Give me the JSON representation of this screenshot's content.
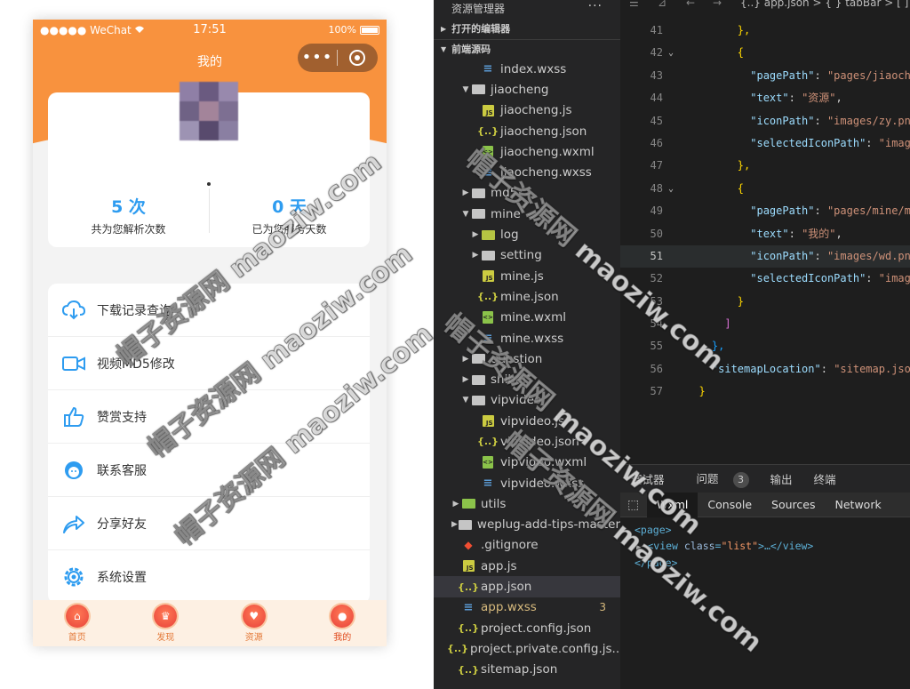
{
  "phone": {
    "status": {
      "carrier": "●●●●● WeChat",
      "time": "17:51",
      "battery": "100%"
    },
    "nav_title": "我的",
    "capsule_more": "•••",
    "stats": [
      {
        "value": "5 次",
        "label": "共为您解析次数"
      },
      {
        "value": "0 天",
        "label": "已为您服务天数"
      }
    ],
    "menu": [
      {
        "label": "下载记录查询",
        "icon": "cloud-download-icon"
      },
      {
        "label": "视频MD5修改",
        "icon": "video-camera-icon"
      },
      {
        "label": "赞赏支持",
        "icon": "thumbs-up-icon"
      },
      {
        "label": "联系客服",
        "icon": "customer-service-icon"
      },
      {
        "label": "分享好友",
        "icon": "share-arrow-icon"
      },
      {
        "label": "系统设置",
        "icon": "settings-gear-icon"
      }
    ],
    "tabs": [
      {
        "label": "首页",
        "icon": "home-icon"
      },
      {
        "label": "发现",
        "icon": "crown-icon"
      },
      {
        "label": "资源",
        "icon": "heart-icon"
      },
      {
        "label": "我的",
        "icon": "user-icon"
      }
    ],
    "accent": "#f8923e",
    "stat_color": "#2e9cf0"
  },
  "explorer": {
    "title": "资源管理器",
    "more": "···",
    "sections": [
      "打开的编辑器",
      "前端源码"
    ],
    "tree": [
      {
        "name": "index.wxss",
        "type": "css",
        "indent": 3
      },
      {
        "name": "jiaocheng",
        "type": "folder-open",
        "indent": 2
      },
      {
        "name": "jiaocheng.js",
        "type": "js",
        "indent": 3
      },
      {
        "name": "jiaocheng.json",
        "type": "json",
        "indent": 3
      },
      {
        "name": "jiaocheng.wxml",
        "type": "wxml",
        "indent": 3
      },
      {
        "name": "jiaocheng.wxss",
        "type": "css",
        "indent": 3
      },
      {
        "name": "md5",
        "type": "folder",
        "indent": 2
      },
      {
        "name": "mine",
        "type": "folder-open",
        "indent": 2
      },
      {
        "name": "log",
        "type": "folder-log",
        "indent": 3
      },
      {
        "name": "setting",
        "type": "folder",
        "indent": 3
      },
      {
        "name": "mine.js",
        "type": "js",
        "indent": 3
      },
      {
        "name": "mine.json",
        "type": "json",
        "indent": 3
      },
      {
        "name": "mine.wxml",
        "type": "wxml",
        "indent": 3
      },
      {
        "name": "mine.wxss",
        "type": "css",
        "indent": 3
      },
      {
        "name": "question",
        "type": "folder",
        "indent": 2
      },
      {
        "name": "shibai",
        "type": "folder",
        "indent": 2
      },
      {
        "name": "vipvideo",
        "type": "folder-open",
        "indent": 2
      },
      {
        "name": "vipvideo.js",
        "type": "js",
        "indent": 3
      },
      {
        "name": "vipvideo.json",
        "type": "json",
        "indent": 3
      },
      {
        "name": "vipvideo.wxml",
        "type": "wxml",
        "indent": 3
      },
      {
        "name": "vipvideo.wxss",
        "type": "css",
        "indent": 3
      },
      {
        "name": "utils",
        "type": "folder-utils",
        "indent": 1
      },
      {
        "name": "weplug-add-tips-master",
        "type": "folder",
        "indent": 1
      },
      {
        "name": ".gitignore",
        "type": "git",
        "indent": 1
      },
      {
        "name": "app.js",
        "type": "js",
        "indent": 1
      },
      {
        "name": "app.json",
        "type": "json",
        "indent": 1,
        "selected": true
      },
      {
        "name": "app.wxss",
        "type": "css",
        "indent": 1,
        "badge": "3",
        "modified": true
      },
      {
        "name": "project.config.json",
        "type": "json",
        "indent": 1
      },
      {
        "name": "project.private.config.js...",
        "type": "json",
        "indent": 1
      },
      {
        "name": "sitemap.json",
        "type": "json",
        "indent": 1
      }
    ]
  },
  "editor": {
    "breadcrumb": "{..} app.json > { } tabBar > [ ]",
    "lines": [
      {
        "no": "41",
        "code": [
          [
            "p",
            "        "
          ],
          [
            "y",
            "},"
          ]
        ]
      },
      {
        "no": "42",
        "fold": "v",
        "code": [
          [
            "p",
            "        "
          ],
          [
            "y",
            "{"
          ]
        ]
      },
      {
        "no": "43",
        "code": [
          [
            "p",
            "          "
          ],
          [
            "k",
            "\"pagePath\""
          ],
          [
            "p",
            ": "
          ],
          [
            "s",
            "\"pages/jiaocheng"
          ]
        ]
      },
      {
        "no": "44",
        "code": [
          [
            "p",
            "          "
          ],
          [
            "k",
            "\"text\""
          ],
          [
            "p",
            ": "
          ],
          [
            "s",
            "\"资源\""
          ],
          [
            "p",
            ","
          ]
        ]
      },
      {
        "no": "45",
        "code": [
          [
            "p",
            "          "
          ],
          [
            "k",
            "\"iconPath\""
          ],
          [
            "p",
            ": "
          ],
          [
            "s",
            "\"images/zy.png\""
          ],
          [
            "p",
            ","
          ]
        ]
      },
      {
        "no": "46",
        "code": [
          [
            "p",
            "          "
          ],
          [
            "k",
            "\"selectedIconPath\""
          ],
          [
            "p",
            ": "
          ],
          [
            "s",
            "\"images/"
          ]
        ]
      },
      {
        "no": "47",
        "code": [
          [
            "p",
            "        "
          ],
          [
            "y",
            "},"
          ]
        ]
      },
      {
        "no": "48",
        "fold": "v",
        "code": [
          [
            "p",
            "        "
          ],
          [
            "y",
            "{"
          ]
        ]
      },
      {
        "no": "49",
        "code": [
          [
            "p",
            "          "
          ],
          [
            "k",
            "\"pagePath\""
          ],
          [
            "p",
            ": "
          ],
          [
            "s",
            "\"pages/mine/mine"
          ]
        ]
      },
      {
        "no": "50",
        "code": [
          [
            "p",
            "          "
          ],
          [
            "k",
            "\"text\""
          ],
          [
            "p",
            ": "
          ],
          [
            "s",
            "\"我的\""
          ],
          [
            "p",
            ","
          ]
        ]
      },
      {
        "no": "51",
        "cur": true,
        "code": [
          [
            "p",
            "          "
          ],
          [
            "k",
            "\"iconPath\""
          ],
          [
            "p",
            ": "
          ],
          [
            "s",
            "\"images/wd.png\""
          ],
          [
            "p",
            ","
          ]
        ]
      },
      {
        "no": "52",
        "code": [
          [
            "p",
            "          "
          ],
          [
            "k",
            "\"selectedIconPath\""
          ],
          [
            "p",
            ": "
          ],
          [
            "s",
            "\"images/"
          ]
        ]
      },
      {
        "no": "53",
        "code": [
          [
            "p",
            "        "
          ],
          [
            "y",
            "}"
          ]
        ]
      },
      {
        "no": "54",
        "code": [
          [
            "p",
            "      "
          ],
          [
            "pu",
            "]"
          ]
        ]
      },
      {
        "no": "55",
        "code": [
          [
            "p",
            "    "
          ],
          [
            "bl",
            "},"
          ]
        ]
      },
      {
        "no": "56",
        "code": [
          [
            "p",
            "    "
          ],
          [
            "k",
            "\"sitemapLocation\""
          ],
          [
            "p",
            ": "
          ],
          [
            "s",
            "\"sitemap.json\""
          ]
        ]
      },
      {
        "no": "57",
        "code": [
          [
            "p",
            "  "
          ],
          [
            "y",
            "}"
          ]
        ]
      }
    ]
  },
  "devtools": {
    "tabs": [
      "调试器",
      "问题",
      "输出",
      "终端"
    ],
    "problem_count": "3",
    "panel_tabs": [
      "Wxml",
      "Console",
      "Sources",
      "Network"
    ],
    "active_panel": "Wxml",
    "xml": {
      "open": "<page>",
      "view_open": "<view",
      "attr": "class",
      "val": "\"list\"",
      "view_rest": ">…</view>",
      "close": "</page>"
    }
  },
  "watermark": {
    "text": "帽子资源网 maoziw.com"
  }
}
